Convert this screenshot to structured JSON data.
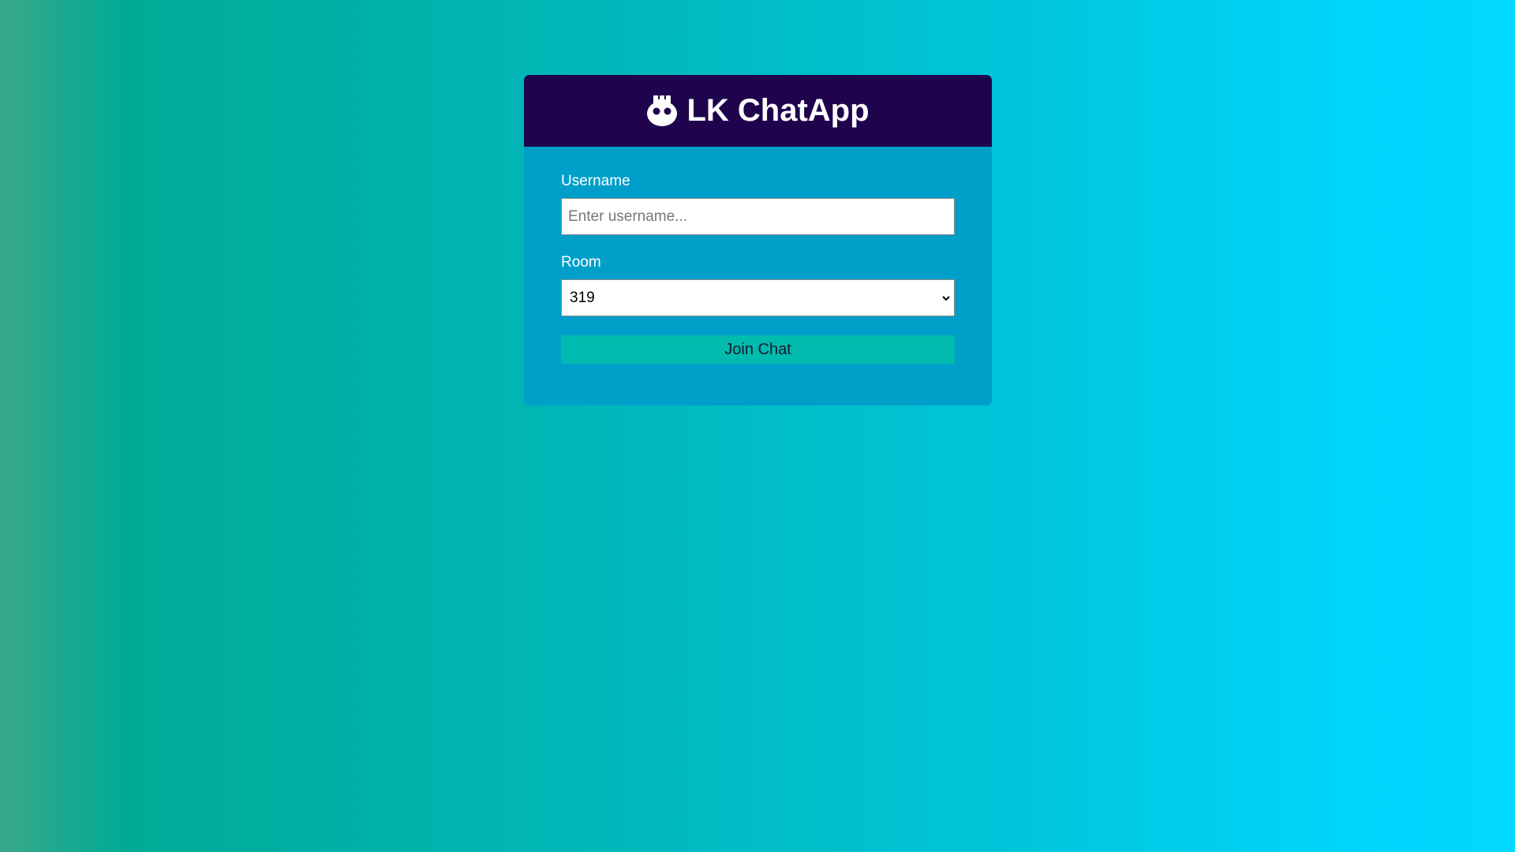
{
  "header": {
    "icon": "robot-icon",
    "title": "LK ChatApp",
    "background_color": "#1f034d"
  },
  "form": {
    "username": {
      "label": "Username",
      "placeholder": "Enter username...",
      "value": ""
    },
    "room": {
      "label": "Room",
      "selected": "319"
    },
    "submit_label": "Join Chat",
    "button_color": "#00bbae",
    "card_color": "#009fca"
  }
}
